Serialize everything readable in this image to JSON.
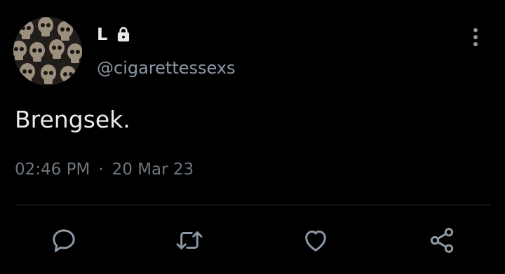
{
  "user": {
    "display_name": "L",
    "handle": "@cigarettessexs",
    "protected_icon": "lock-icon",
    "avatar": "skulls-avatar"
  },
  "tweet": {
    "text": "Brengsek.",
    "time": "02:46 PM",
    "separator": "·",
    "date": "20 Mar 23"
  },
  "actions": {
    "more": "more-vertical-icon",
    "reply": "comment-icon",
    "retweet": "retweet-icon",
    "like": "heart-icon",
    "share": "share-icon"
  },
  "colors": {
    "background": "#000000",
    "primary_text": "#e7e9ea",
    "secondary_text": "#8b98a5",
    "divider": "#2f3336",
    "icon": "#8b98a5"
  }
}
